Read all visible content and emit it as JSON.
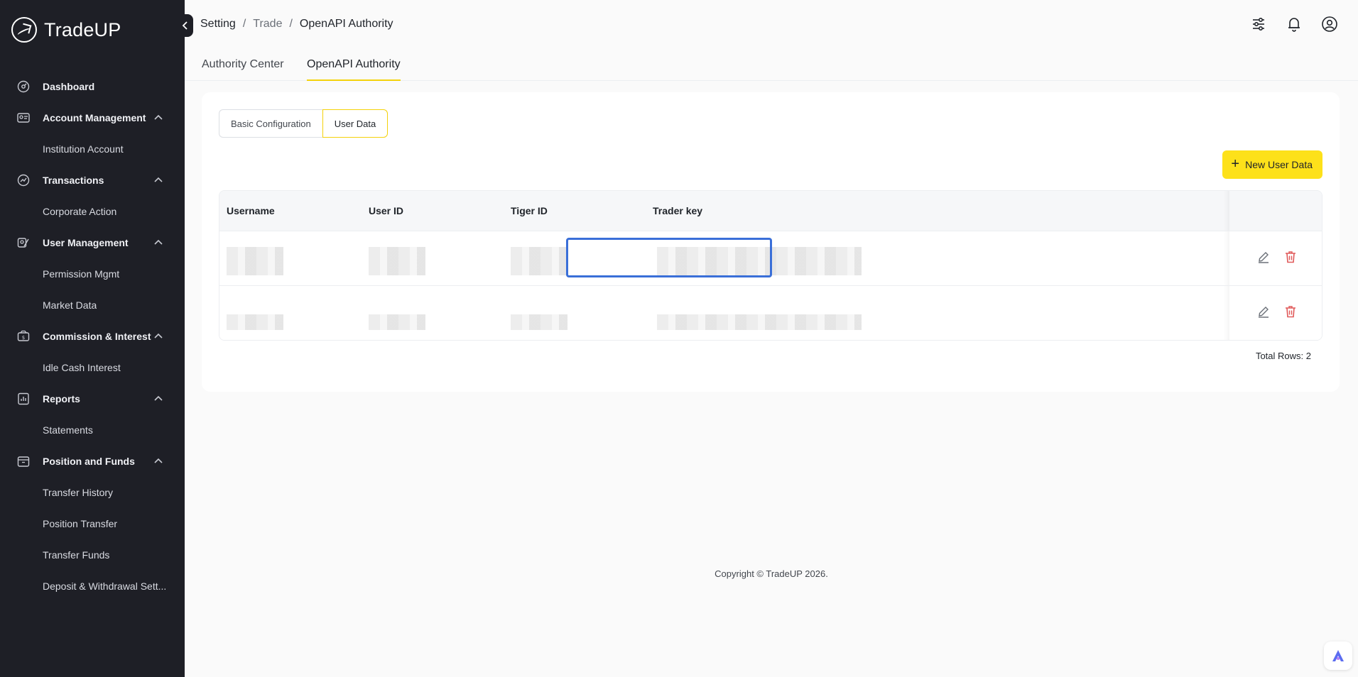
{
  "brand": {
    "name": "TradeUP"
  },
  "sidebar": {
    "items": [
      {
        "label": "Dashboard",
        "icon": "dashboard-icon",
        "children": []
      },
      {
        "label": "Account Management",
        "icon": "account-icon",
        "children": [
          "Institution Account"
        ]
      },
      {
        "label": "Transactions",
        "icon": "transactions-icon",
        "children": [
          "Corporate Action"
        ]
      },
      {
        "label": "User Management",
        "icon": "user-management-icon",
        "children": [
          "Permission Mgmt",
          "Market Data"
        ]
      },
      {
        "label": "Commission & Interest",
        "icon": "commission-icon",
        "children": [
          "Idle Cash Interest"
        ]
      },
      {
        "label": "Reports",
        "icon": "reports-icon",
        "children": [
          "Statements"
        ]
      },
      {
        "label": "Position and Funds",
        "icon": "position-funds-icon",
        "children": [
          "Transfer History",
          "Position Transfer",
          "Transfer Funds",
          "Deposit & Withdrawal Sett..."
        ]
      }
    ]
  },
  "breadcrumb": {
    "items": [
      "Setting",
      "Trade",
      "OpenAPI Authority"
    ],
    "separator": "/"
  },
  "tabs": [
    {
      "label": "Authority Center",
      "active": false
    },
    {
      "label": "OpenAPI Authority",
      "active": true
    }
  ],
  "segment": [
    {
      "label": "Basic Configuration",
      "active": false
    },
    {
      "label": "User Data",
      "active": true
    }
  ],
  "actions": {
    "new_label": "New User Data"
  },
  "table": {
    "columns": [
      "Username",
      "User ID",
      "Tiger ID",
      "Trader key"
    ],
    "rows": [
      {
        "username": "",
        "user_id": "",
        "tiger_id": "",
        "trader_key": ""
      },
      {
        "username": "",
        "user_id": "",
        "tiger_id": "",
        "trader_key": ""
      }
    ]
  },
  "pagination": {
    "total_label": "Total Rows: 2"
  },
  "footer": {
    "copyright": "Copyright © TradeUP 2026."
  },
  "colors": {
    "sidebar_bg": "#1e1f26",
    "accent": "#fde11a",
    "focus": "#3a6fd8",
    "delete": "#e05a5a"
  }
}
